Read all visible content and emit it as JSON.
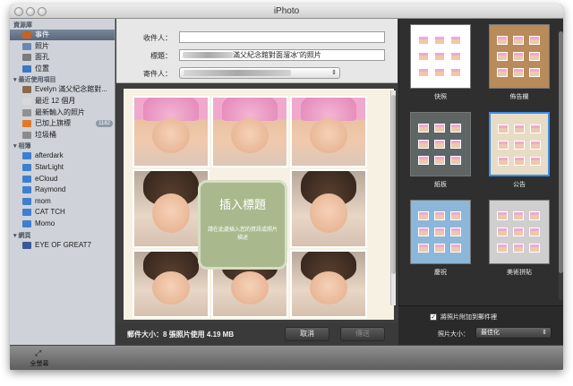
{
  "window": {
    "title": "iPhoto"
  },
  "sidebar": {
    "sections": [
      {
        "heading": "資源庫",
        "items": [
          {
            "label": "事件",
            "icon": "events-icon",
            "color": "#c2632a",
            "selected": true
          },
          {
            "label": "照片",
            "icon": "photos-icon",
            "color": "#6a88b5"
          },
          {
            "label": "面孔",
            "icon": "faces-icon",
            "color": "#7b7b7b"
          },
          {
            "label": "位置",
            "icon": "places-icon",
            "color": "#3a78c8"
          }
        ]
      },
      {
        "heading": "最近使用項目",
        "items": [
          {
            "label": "Evelyn 滿父紀念館對...",
            "icon": "event-icon",
            "color": "#8a6a4a"
          },
          {
            "label": "最近 12 個月",
            "icon": "calendar-icon",
            "color": "#d9d9d9"
          },
          {
            "label": "最新輸入的照片",
            "icon": "import-clock-icon",
            "color": "#909090"
          },
          {
            "label": "已加上旗標",
            "icon": "flag-icon",
            "color": "#e07a28",
            "badge": "1182"
          },
          {
            "label": "垃圾桶",
            "icon": "trash-icon",
            "color": "#8b8b8b"
          }
        ]
      },
      {
        "heading": "相簿",
        "items": [
          {
            "label": "afterdark",
            "icon": "album-icon",
            "color": "#3f7fd0"
          },
          {
            "label": "StarLight",
            "icon": "album-icon",
            "color": "#3f7fd0"
          },
          {
            "label": "eCloud",
            "icon": "album-icon",
            "color": "#3f7fd0"
          },
          {
            "label": "Raymond",
            "icon": "album-icon",
            "color": "#3f7fd0"
          },
          {
            "label": "mom",
            "icon": "album-icon",
            "color": "#3f7fd0"
          },
          {
            "label": "CAT TCH",
            "icon": "album-icon",
            "color": "#3f7fd0"
          },
          {
            "label": "Momo",
            "icon": "album-icon",
            "color": "#3f7fd0"
          }
        ]
      },
      {
        "heading": "網頁",
        "items": [
          {
            "label": "EYE OF GREAT7",
            "icon": "facebook-icon",
            "color": "#3b5998"
          }
        ]
      }
    ]
  },
  "email_form": {
    "to_label": "收件人：",
    "to_value": "",
    "subject_label": "標題：",
    "subject_value": "滿父紀念館對面溜冰\"的照片",
    "from_label": "寄件人："
  },
  "card": {
    "title": "插入標題",
    "subtitle": "請在此處插入您的資訊或照片描述"
  },
  "footer": {
    "size_text": "郵件大小：8 張照片使用 4.19 MB",
    "cancel_label": "取消",
    "send_label": "傳送"
  },
  "templates": [
    {
      "caption": "快照",
      "bg": "#ffffff",
      "selected": false
    },
    {
      "caption": "佈告欄",
      "bg": "#b98a5a",
      "selected": false
    },
    {
      "caption": "紙板",
      "bg": "#5f6464",
      "selected": false
    },
    {
      "caption": "公告",
      "bg": "#e7dcc5",
      "selected": true
    },
    {
      "caption": "慶祝",
      "bg": "#8cb7d9",
      "selected": false
    },
    {
      "caption": "美術拼貼",
      "bg": "#cfcfcf",
      "selected": false
    }
  ],
  "options": {
    "attach_checked": true,
    "attach_label": "將照片附加到郵件裡",
    "size_label": "照片大小：",
    "size_value": "最佳化"
  },
  "bottom_toolbar": {
    "fullscreen_label": "全螢幕"
  }
}
